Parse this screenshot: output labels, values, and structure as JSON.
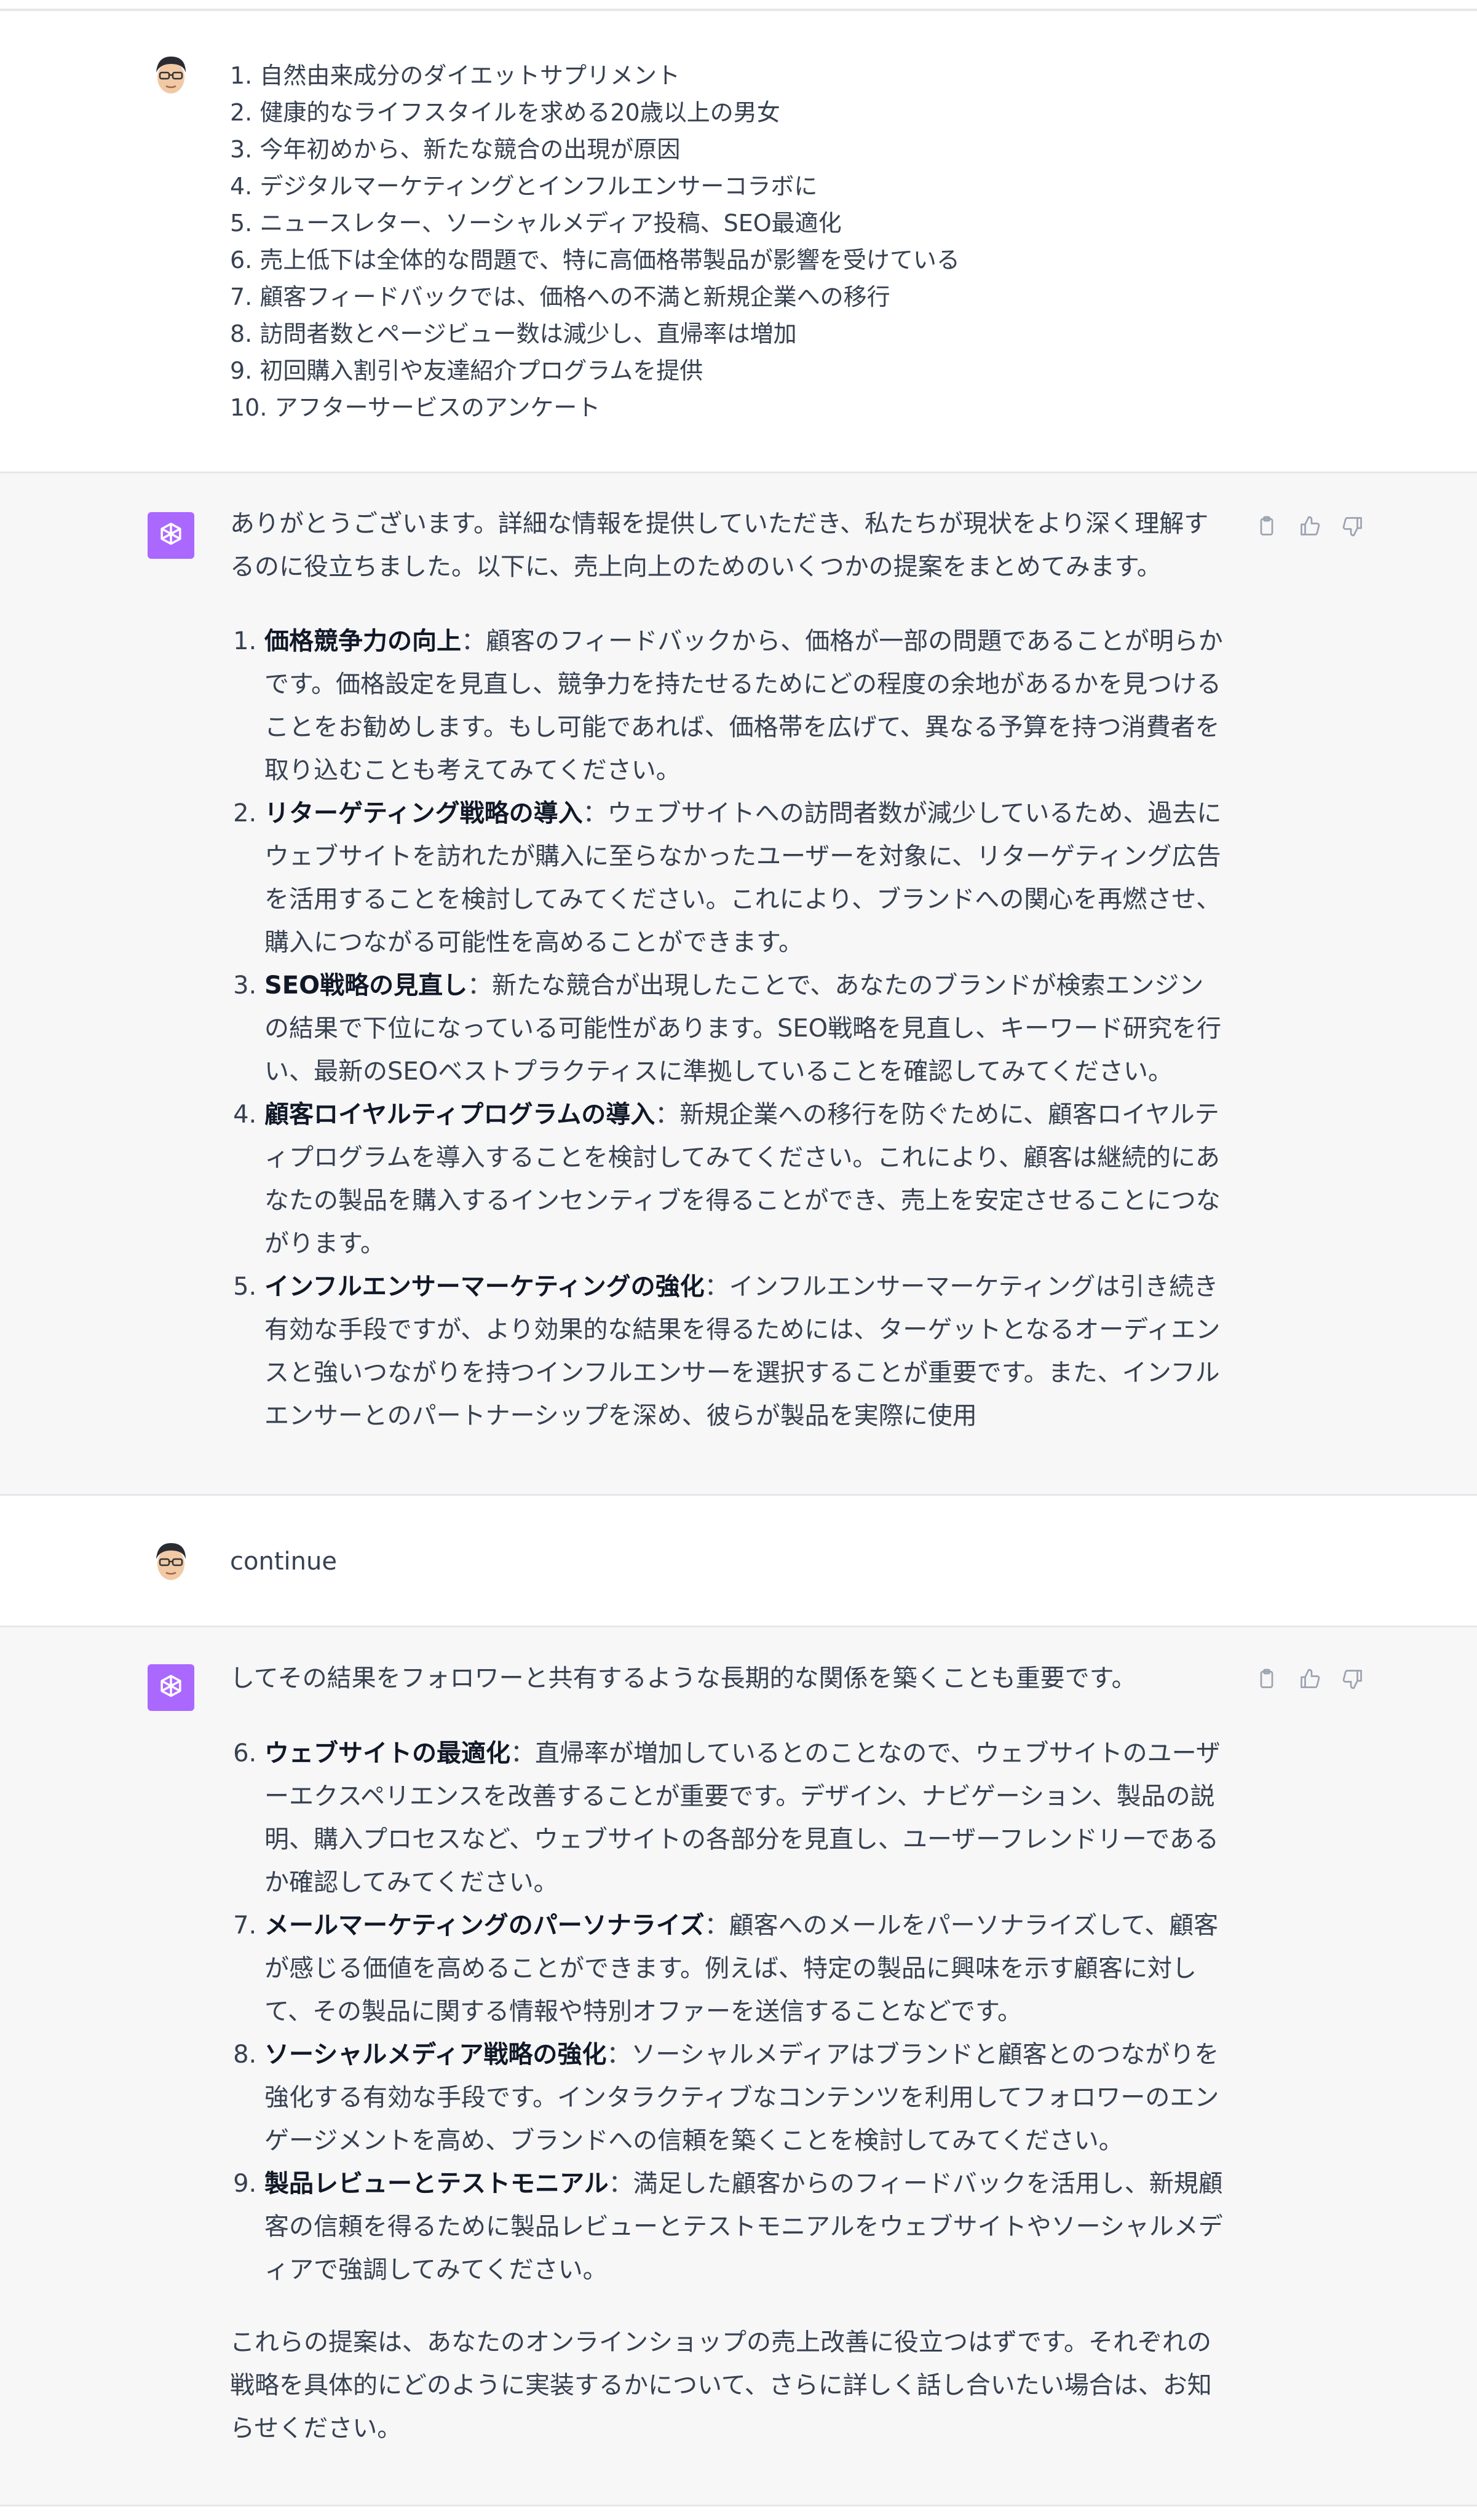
{
  "message1": {
    "items": [
      "1. 自然由来成分のダイエットサプリメント",
      "2. 健康的なライフスタイルを求める20歳以上の男女",
      "3. 今年初めから、新たな競合の出現が原因",
      "4. デジタルマーケティングとインフルエンサーコラボに",
      "5. ニュースレター、ソーシャルメディア投稿、SEO最適化",
      "6. 売上低下は全体的な問題で、特に高価格帯製品が影響を受けている",
      "7. 顧客フィードバックでは、価格への不満と新規企業への移行",
      "8. 訪問者数とページビュー数は減少し、直帰率は増加",
      "9. 初回購入割引や友達紹介プログラムを提供",
      "10. アフターサービスのアンケート"
    ]
  },
  "message2": {
    "intro": "ありがとうございます。詳細な情報を提供していただき、私たちが現状をより深く理解するのに役立ちました。以下に、売上向上のためのいくつかの提案をまとめてみます。",
    "items": [
      {
        "title": "価格競争力の向上",
        "body": "：顧客のフィードバックから、価格が一部の問題であることが明らかです。価格設定を見直し、競争力を持たせるためにどの程度の余地があるかを見つけることをお勧めします。もし可能であれば、価格帯を広げて、異なる予算を持つ消費者を取り込むことも考えてみてください。"
      },
      {
        "title": "リターゲティング戦略の導入",
        "body": "：ウェブサイトへの訪問者数が減少しているため、過去にウェブサイトを訪れたが購入に至らなかったユーザーを対象に、リターゲティング広告を活用することを検討してみてください。これにより、ブランドへの関心を再燃させ、購入につながる可能性を高めることができます。"
      },
      {
        "title": "SEO戦略の見直し",
        "body": "：新たな競合が出現したことで、あなたのブランドが検索エンジンの結果で下位になっている可能性があります。SEO戦略を見直し、キーワード研究を行い、最新のSEOベストプラクティスに準拠していることを確認してみてください。"
      },
      {
        "title": "顧客ロイヤルティプログラムの導入",
        "body": "：新規企業への移行を防ぐために、顧客ロイヤルティプログラムを導入することを検討してみてください。これにより、顧客は継続的にあなたの製品を購入するインセンティブを得ることができ、売上を安定させることにつながります。"
      },
      {
        "title": "インフルエンサーマーケティングの強化",
        "body": "：インフルエンサーマーケティングは引き続き有効な手段ですが、より効果的な結果を得るためには、ターゲットとなるオーディエンスと強いつながりを持つインフルエンサーを選択することが重要です。また、インフルエンサーとのパートナーシップを深め、彼らが製品を実際に使用"
      }
    ]
  },
  "message3": {
    "text": "continue"
  },
  "message4": {
    "intro": "してその結果をフォロワーと共有するような長期的な関係を築くことも重要です。",
    "items": [
      {
        "title": "ウェブサイトの最適化",
        "body": "：直帰率が増加しているとのことなので、ウェブサイトのユーザーエクスペリエンスを改善することが重要です。デザイン、ナビゲーション、製品の説明、購入プロセスなど、ウェブサイトの各部分を見直し、ユーザーフレンドリーであるか確認してみてください。"
      },
      {
        "title": "メールマーケティングのパーソナライズ",
        "body": "：顧客へのメールをパーソナライズして、顧客が感じる価値を高めることができます。例えば、特定の製品に興味を示す顧客に対して、その製品に関する情報や特別オファーを送信することなどです。"
      },
      {
        "title": "ソーシャルメディア戦略の強化",
        "body": "：ソーシャルメディアはブランドと顧客とのつながりを強化する有効な手段です。インタラクティブなコンテンツを利用してフォロワーのエンゲージメントを高め、ブランドへの信頼を築くことを検討してみてください。"
      },
      {
        "title": "製品レビューとテストモニアル",
        "body": "：満足した顧客からのフィードバックを活用し、新規顧客の信頼を得るために製品レビューとテストモニアルをウェブサイトやソーシャルメディアで強調してみてください。"
      }
    ],
    "outro": "これらの提案は、あなたのオンラインショップの売上改善に役立つはずです。それぞれの戦略を具体的にどのように実装するかについて、さらに詳しく話し合いたい場合は、お知らせください。"
  },
  "icons": [
    "user-avatar",
    "chatgpt-logo",
    "copy-icon",
    "thumbs-up-icon",
    "thumbs-down-icon"
  ],
  "colors": {
    "assistant_bg": "#f7f7f8",
    "user_bg": "#ffffff",
    "logo_bg": "#ab68ff"
  }
}
